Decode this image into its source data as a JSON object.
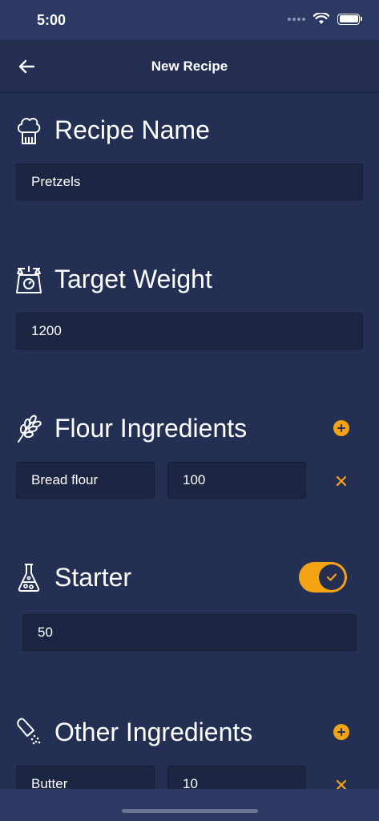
{
  "status_bar": {
    "time": "5:00"
  },
  "nav": {
    "title": "New Recipe"
  },
  "recipe_name": {
    "title": "Recipe Name",
    "value": "Pretzels"
  },
  "target_weight": {
    "title": "Target Weight",
    "value": "1200"
  },
  "flour": {
    "title": "Flour Ingredients",
    "rows": [
      {
        "name": "Bread flour",
        "amount": "100"
      }
    ]
  },
  "starter": {
    "title": "Starter",
    "enabled": true,
    "value": "50"
  },
  "other": {
    "title": "Other Ingredients",
    "rows": [
      {
        "name": "Butter",
        "amount": "10"
      }
    ]
  },
  "colors": {
    "background": "#243053",
    "field": "#1c2542",
    "accent": "#f6a313"
  },
  "icons": {
    "back": "arrow-left-icon",
    "recipe_name": "chef-hat-icon",
    "target_weight": "kitchen-scale-icon",
    "flour": "wheat-icon",
    "starter": "flask-icon",
    "other": "salt-shaker-icon",
    "add": "plus-circle-icon",
    "remove": "close-icon",
    "toggle_on": "check-icon"
  }
}
